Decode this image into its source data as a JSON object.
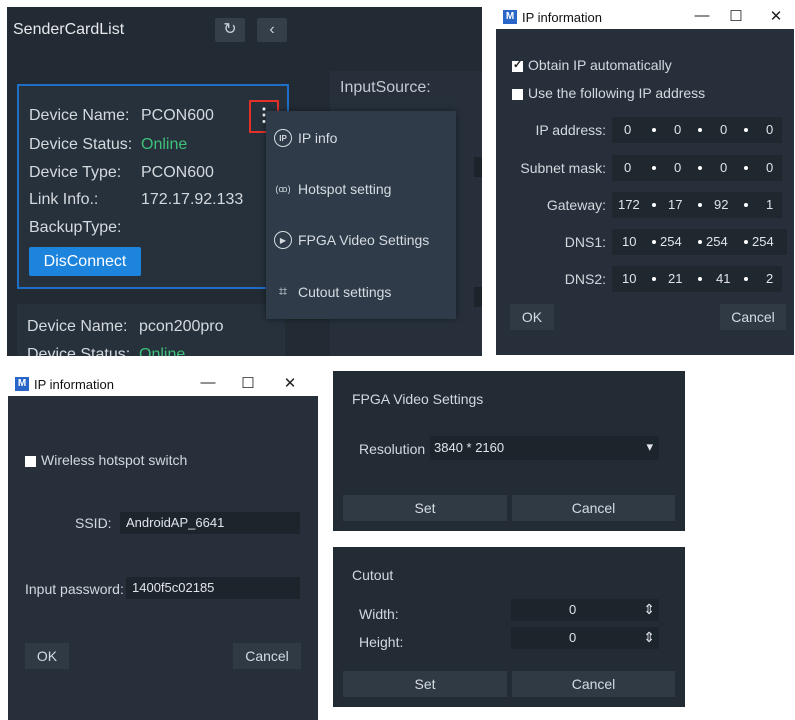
{
  "sender": {
    "title": "SenderCardList",
    "refresh_icon": "↻",
    "back_icon": "‹",
    "input_source_label": "InputSource:",
    "card1": {
      "name_label": "Device Name:",
      "name_value": "PCON600",
      "status_label": "Device Status:",
      "status_value": "Online",
      "type_label": "Device Type:",
      "type_value": "PCON600",
      "link_label": "Link Info.:",
      "link_value": "172.17.92.133",
      "backup_label": "BackupType:",
      "disconnect_label": "DisConnect"
    },
    "card2": {
      "name_label": "Device Name:",
      "name_value": "pcon200pro",
      "status_label": "Device Status:",
      "status_value": "Online"
    },
    "menu": {
      "items": [
        {
          "label": "IP info",
          "icon": "ip-icon",
          "glyph": "IP"
        },
        {
          "label": "Hotspot setting",
          "icon": "hotspot-icon",
          "glyph": "(ꝏ)"
        },
        {
          "label": "FPGA Video Settings",
          "icon": "play-icon",
          "glyph": "▶"
        },
        {
          "label": "Cutout settings",
          "icon": "crop-icon",
          "glyph": "⌗"
        }
      ]
    },
    "colors": {
      "accent": "#1d84dd",
      "online": "#3ec07a",
      "highlight": "#e2312b"
    }
  },
  "ip_window": {
    "title": "IP information",
    "logo_glyph": "M",
    "controls": {
      "min": "—",
      "max": "☐",
      "close": "✕"
    },
    "obtain_auto_label": "Obtain IP automatically",
    "obtain_auto_checked": true,
    "use_following_label": "Use the following IP address",
    "use_following_checked": false,
    "fields": [
      {
        "label": "IP address:",
        "octets": [
          "0",
          "0",
          "0",
          "0"
        ]
      },
      {
        "label": "Subnet mask:",
        "octets": [
          "0",
          "0",
          "0",
          "0"
        ]
      },
      {
        "label": "Gateway:",
        "octets": [
          "172",
          "17",
          "92",
          "1"
        ]
      },
      {
        "label": "DNS1:",
        "octets": [
          "10",
          "254",
          "254",
          "254"
        ]
      },
      {
        "label": "DNS2:",
        "octets": [
          "10",
          "21",
          "41",
          "2"
        ]
      }
    ],
    "ok_label": "OK",
    "cancel_label": "Cancel"
  },
  "hotspot_window": {
    "title": "IP information",
    "logo_glyph": "M",
    "controls": {
      "min": "—",
      "max": "☐",
      "close": "✕"
    },
    "switch_label": "Wireless hotspot switch",
    "switch_checked": false,
    "ssid_label": "SSID:",
    "ssid_value": "AndroidAP_6641",
    "password_label": "Input password:",
    "password_value": "1400f5c02185",
    "ok_label": "OK",
    "cancel_label": "Cancel"
  },
  "fpga": {
    "title": "FPGA Video Settings",
    "resolution_label": "Resolution",
    "resolution_value": "3840 * 2160",
    "dropdown_icon": "▾",
    "set_label": "Set",
    "cancel_label": "Cancel"
  },
  "cutout": {
    "title": "Cutout",
    "width_label": "Width:",
    "width_value": "0",
    "height_label": "Height:",
    "height_value": "0",
    "spin_icon": "⇕",
    "set_label": "Set",
    "cancel_label": "Cancel"
  }
}
